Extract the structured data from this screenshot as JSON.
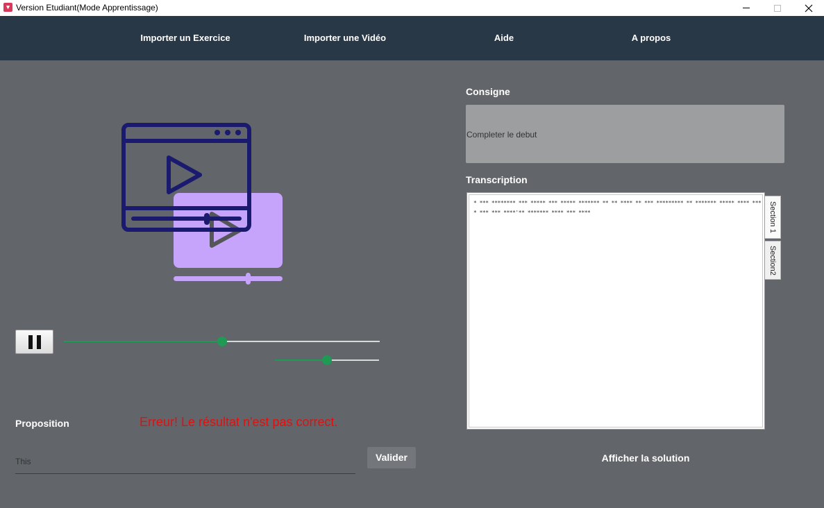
{
  "window": {
    "title": "Version Etudiant(Mode Apprentissage)",
    "icon": "app-icon",
    "controls": [
      "minimize-icon",
      "maximize-icon",
      "close-icon"
    ]
  },
  "nav": {
    "items": [
      {
        "label": "Importer un Exercice"
      },
      {
        "label": "Importer une Vidéo"
      },
      {
        "label": "Aide"
      },
      {
        "label": "A propos"
      }
    ]
  },
  "player": {
    "illustration": "video-player-icon",
    "pause_icon": "pause-icon",
    "progress": 0.5,
    "volume": 0.5
  },
  "proposition": {
    "label": "Proposition",
    "error_message": "Erreur! Le résultat n'est pas correct.",
    "input_value": "This",
    "submit_label": "Valider"
  },
  "consigne": {
    "label": "Consigne",
    "text": "Completer le debut"
  },
  "transcription": {
    "label": "Transcription",
    "text": "* *** ******** *** ***** *** ***** ******* ** ** **** ** *** ********* ** ******* ***** **** **** *** *** ****'** ******* **** *** ****",
    "tabs": [
      {
        "label": "Section 1"
      },
      {
        "label": "Section2"
      }
    ]
  },
  "solution_button": {
    "label": "Afficher la solution"
  },
  "colors": {
    "navbar": "#293846",
    "background": "#626569",
    "slider_accent": "#1e9a54",
    "error": "#e01010",
    "illustration_dark": "#1a1a6e",
    "illustration_light": "#c6a4fb"
  }
}
